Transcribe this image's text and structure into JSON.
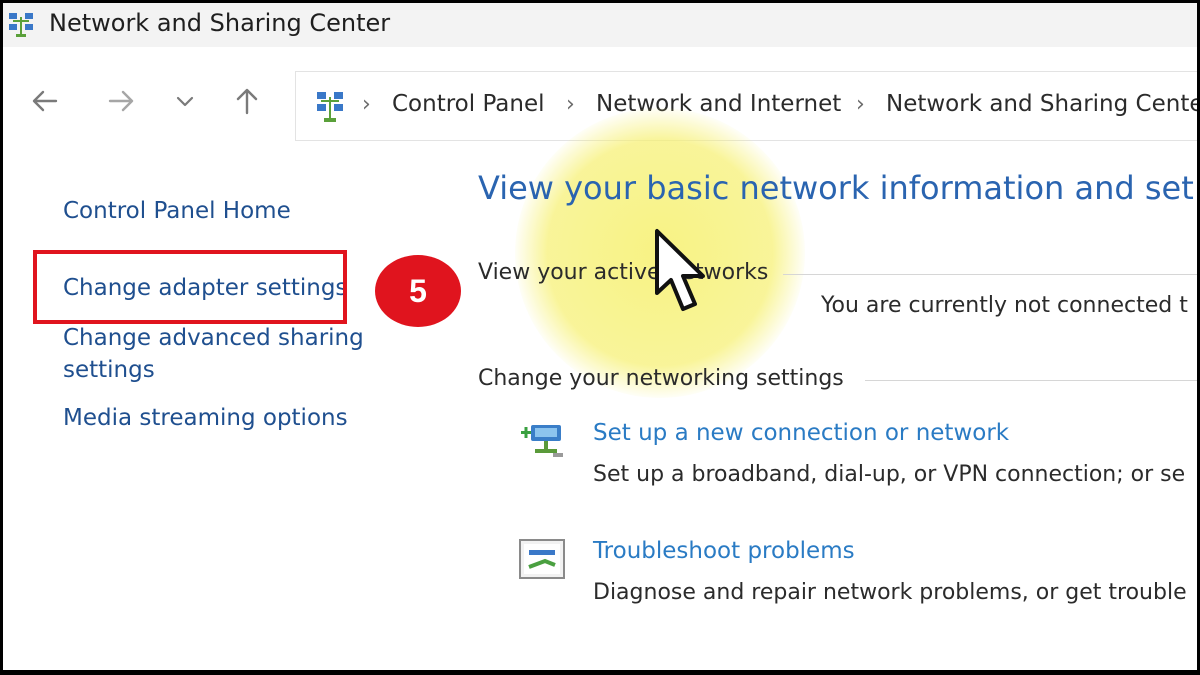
{
  "window": {
    "title": "Network and Sharing Center"
  },
  "nav": {
    "back_icon": "arrow-left-icon",
    "forward_icon": "arrow-right-icon",
    "recent_icon": "chevron-down-icon",
    "up_icon": "arrow-up-icon"
  },
  "address_bar": {
    "crumbs": [
      "Control Panel",
      "Network and Internet",
      "Network and Sharing Cente"
    ]
  },
  "sidebar": {
    "items": [
      {
        "label": "Control Panel Home"
      },
      {
        "label": "Change adapter settings"
      },
      {
        "label_line1": "Change advanced sharing",
        "label_line2": "settings"
      },
      {
        "label": "Media streaming options"
      }
    ]
  },
  "annotation": {
    "step_number": "5",
    "accent_color": "#e0141e"
  },
  "main": {
    "heading": "View your basic network information and set up",
    "active_networks": {
      "label": "View your active networks",
      "status": "You are currently not connected t"
    },
    "networking_settings": {
      "label": "Change your networking settings",
      "tasks": [
        {
          "link": "Set up a new connection or network",
          "description": "Set up a broadband, dial-up, or VPN connection; or se"
        },
        {
          "link": "Troubleshoot problems",
          "description": "Diagnose and repair network problems, or get trouble"
        }
      ]
    }
  },
  "colors": {
    "link": "#2a7bc4",
    "heading": "#2a64b0",
    "highlight": "#f6f06e"
  }
}
